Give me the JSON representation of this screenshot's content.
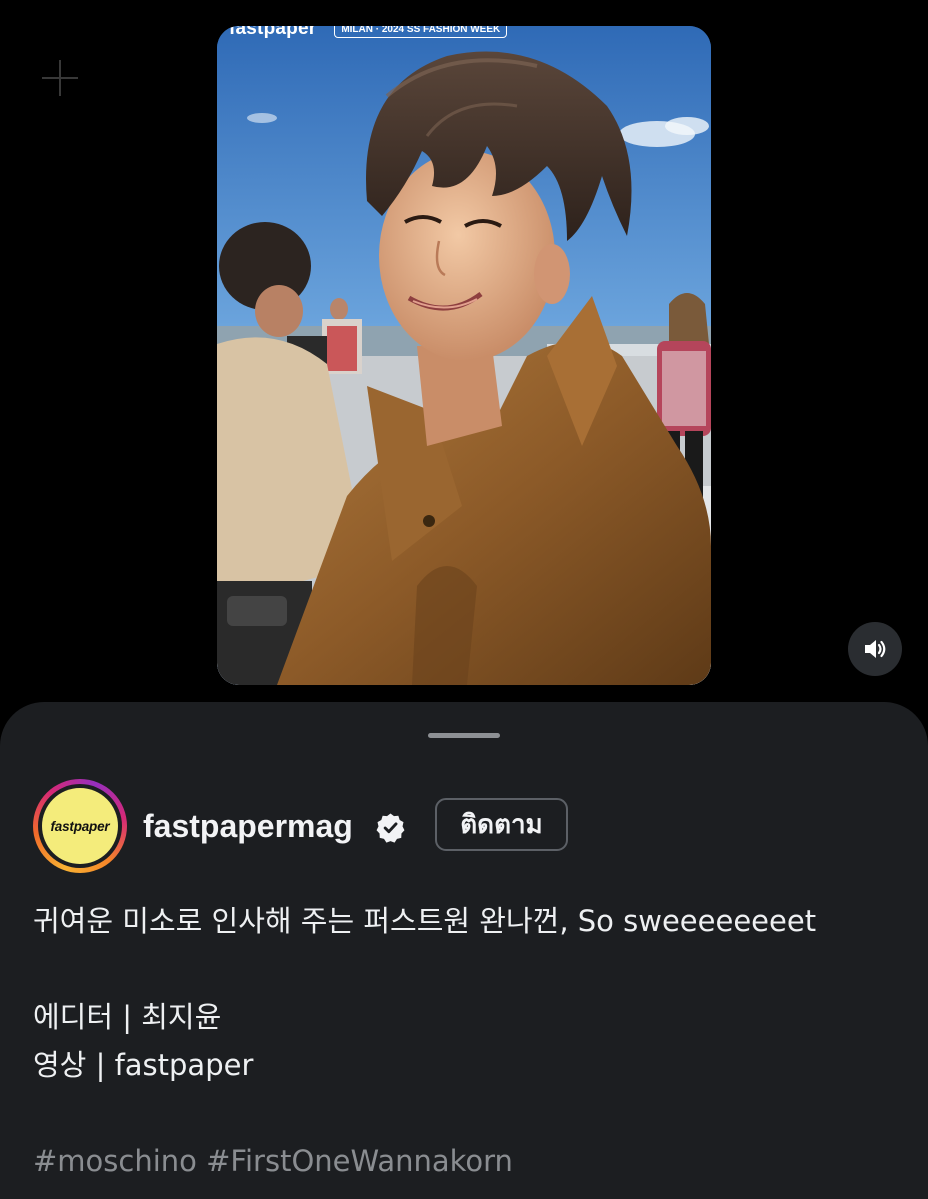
{
  "video": {
    "watermark_brand": "fastpaper",
    "watermark_badge": "MILAN · 2024 SS FASHION WEEK",
    "sound_icon": "speaker-on-icon"
  },
  "post": {
    "username": "fastpapermag",
    "verified_icon": "verified-badge-icon",
    "avatar_text": "fastpaper",
    "follow_label": "ติดตาม",
    "caption_line1": "귀여운 미소로 인사해 주는 퍼스트원 완나껀, So sweeeeeeeet",
    "caption_line2": "에디터 | 최지윤",
    "caption_line3": "영상 | fastpaper",
    "hashtag1": "#moschino",
    "hashtag2": "#FirstOneWannakorn"
  },
  "colors": {
    "sheet_bg": "#1c1e21",
    "avatar_bg": "#f4ec7b",
    "hashtag": "#8a8d91"
  }
}
